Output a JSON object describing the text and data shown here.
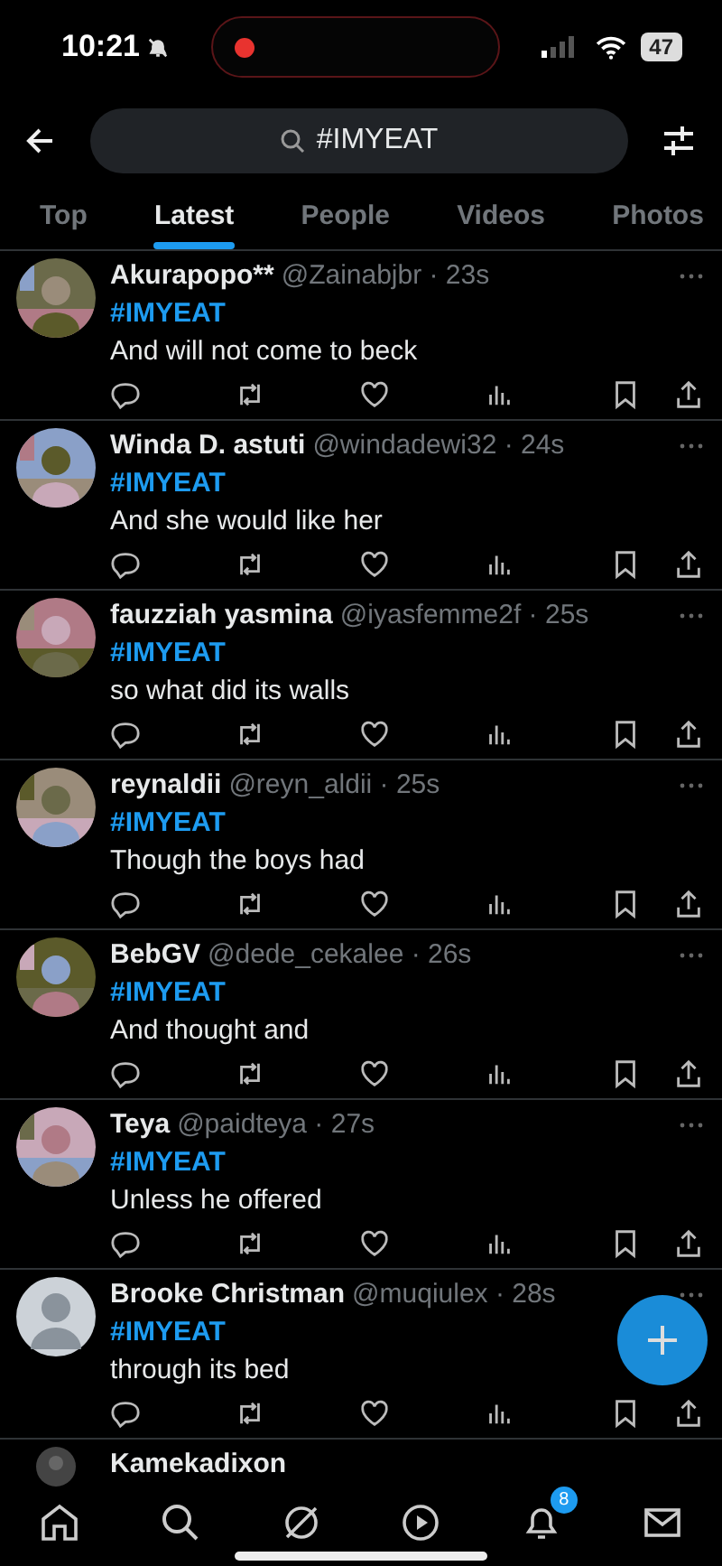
{
  "status_bar": {
    "time": "10:21",
    "battery": "47"
  },
  "search": {
    "query": "#IMYEAT"
  },
  "tabs": [
    {
      "label": "Top",
      "selected": false
    },
    {
      "label": "Latest",
      "selected": true
    },
    {
      "label": "People",
      "selected": false
    },
    {
      "label": "Videos",
      "selected": false
    },
    {
      "label": "Photos",
      "selected": false
    }
  ],
  "posts": [
    {
      "name": "Akurapopo**",
      "handle_time": "@Zainabjbr · 23s",
      "hashtag": "#IMYEAT",
      "text": "And will not come to beck"
    },
    {
      "name": "Winda D. astuti",
      "handle_time": "@windadewi32 · 24s",
      "hashtag": "#IMYEAT",
      "text": "And she would like her"
    },
    {
      "name": "fauzziah yasmina",
      "handle_time": "@iyasfemme2f · 25s",
      "hashtag": "#IMYEAT",
      "text": "so what did its walls"
    },
    {
      "name": "reynaldii",
      "handle_time": "@reyn_aldii · 25s",
      "hashtag": "#IMYEAT",
      "text": "Though the boys had"
    },
    {
      "name": "BebGV",
      "handle_time": "@dede_cekalee · 26s",
      "hashtag": "#IMYEAT",
      "text": "And thought and"
    },
    {
      "name": "Teya",
      "handle_time": "@paidteya · 27s",
      "hashtag": "#IMYEAT",
      "text": "Unless he offered"
    },
    {
      "name": "Brooke Christman",
      "handle_time": "@muqiulex · 28s",
      "hashtag": "#IMYEAT",
      "text": "through its bed",
      "avatar": {
        "kind": "default"
      }
    }
  ],
  "partial_post": {
    "name": "Kamekadixon"
  },
  "bottom_nav": {
    "notification_count": "8"
  }
}
